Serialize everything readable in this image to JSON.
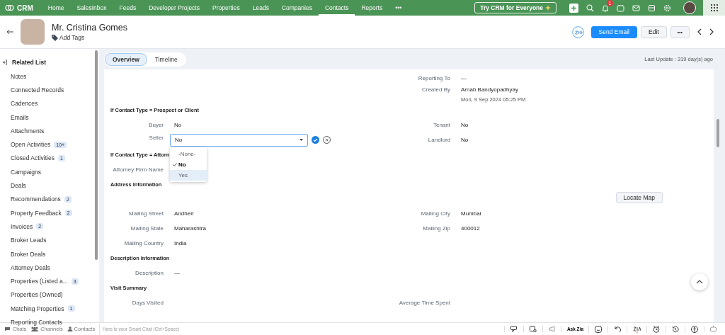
{
  "top_nav": {
    "logo": "CRM",
    "items": [
      {
        "label": "Home",
        "selected": false
      },
      {
        "label": "SalesInbox",
        "selected": false
      },
      {
        "label": "Feeds",
        "selected": false
      },
      {
        "label": "Developer Projects",
        "selected": false
      },
      {
        "label": "Properties",
        "selected": false
      },
      {
        "label": "Leads",
        "selected": false
      },
      {
        "label": "Companies",
        "selected": false
      },
      {
        "label": "Contacts",
        "selected": true
      },
      {
        "label": "Reports",
        "selected": false
      }
    ],
    "more": "•••",
    "try_button": "Try CRM for Everyone",
    "notification_count": "1"
  },
  "record": {
    "name": "Mr. Cristina Gomes",
    "add_tags": "Add Tags",
    "send_email": "Send Email",
    "edit": "Edit",
    "more": "•••"
  },
  "sidebar": {
    "title": "Related List",
    "items": [
      {
        "label": "Notes"
      },
      {
        "label": "Connected Records"
      },
      {
        "label": "Cadences"
      },
      {
        "label": "Emails"
      },
      {
        "label": "Attachments"
      },
      {
        "label": "Open Activities",
        "count": "10+"
      },
      {
        "label": "Closed Activities",
        "count": "1"
      },
      {
        "label": "Campaigns"
      },
      {
        "label": "Deals"
      },
      {
        "label": "Recommendations",
        "count": "2"
      },
      {
        "label": "Property Feedback",
        "count": "2"
      },
      {
        "label": "Invoices",
        "count": "2"
      },
      {
        "label": "Broker Leads"
      },
      {
        "label": "Broker Deals"
      },
      {
        "label": "Attorney Deals"
      },
      {
        "label": "Properties (Listed a...",
        "count": "3"
      },
      {
        "label": "Properties (Owned)"
      },
      {
        "label": "Matching Properties",
        "count": "1"
      },
      {
        "label": "Reporting Contacts"
      }
    ]
  },
  "tabs": [
    {
      "label": "Overview",
      "selected": true
    },
    {
      "label": "Timeline",
      "selected": false
    }
  ],
  "last_update": "Last Update : 319 day(s) ago",
  "details": [
    {
      "kind": "rows",
      "rows": [
        {
          "right": {
            "label": "Reporting To",
            "value": "—"
          }
        },
        {
          "right": {
            "label": "Created By",
            "value": "Arnab Bandyopadhyay",
            "subvalue": "Mon, 9 Sep 2024 05:25 PM"
          }
        }
      ]
    },
    {
      "kind": "heading",
      "text": "If Contact Type = Prospect or Client"
    },
    {
      "kind": "rows",
      "rows": [
        {
          "left": {
            "label": "Buyer",
            "value": "No"
          },
          "right": {
            "label": "Tenant",
            "value": "No"
          }
        },
        {
          "left": {
            "label": "Seller",
            "value": "No",
            "editing": true,
            "options": [
              {
                "label": "-None-",
                "selected": false,
                "highlighted": false
              },
              {
                "label": "No",
                "selected": true,
                "highlighted": false
              },
              {
                "label": "Yes",
                "selected": false,
                "highlighted": true
              }
            ]
          },
          "right": {
            "label": "Landlord",
            "value": "No"
          }
        }
      ]
    },
    {
      "kind": "heading",
      "text": "If Contact Type = Attorn"
    },
    {
      "kind": "rows",
      "rows": [
        {
          "left": {
            "label": "Attorney Firm Name"
          }
        }
      ]
    },
    {
      "kind": "heading",
      "text": "Address Information",
      "button": "Locate Map"
    },
    {
      "kind": "rows",
      "rows": [
        {
          "left": {
            "label": "Mailing Street",
            "value": "Andheri"
          },
          "right": {
            "label": "Mailing City",
            "value": "Mumbai"
          }
        },
        {
          "left": {
            "label": "Mailing State",
            "value": "Maharashtra"
          },
          "right": {
            "label": "Mailing Zip",
            "value": "400012"
          }
        },
        {
          "left": {
            "label": "Mailing Country",
            "value": "India"
          }
        }
      ]
    },
    {
      "kind": "heading",
      "text": "Description Information"
    },
    {
      "kind": "rows",
      "rows": [
        {
          "left": {
            "label": "Description",
            "value": "—"
          }
        }
      ]
    },
    {
      "kind": "heading",
      "text": "Visit Summary"
    },
    {
      "kind": "rows",
      "rows": [
        {
          "left": {
            "label": "Days Visited"
          },
          "right": {
            "label": "Average Time Spent"
          }
        }
      ]
    }
  ],
  "bottom_bar": {
    "apps": [
      {
        "label": "Chats"
      },
      {
        "label": "Channels"
      },
      {
        "label": "Contacts"
      }
    ],
    "chat_placeholder": "Here is your Smart Chat (Ctrl+Space)",
    "ask_zia": "Ask Zia"
  }
}
